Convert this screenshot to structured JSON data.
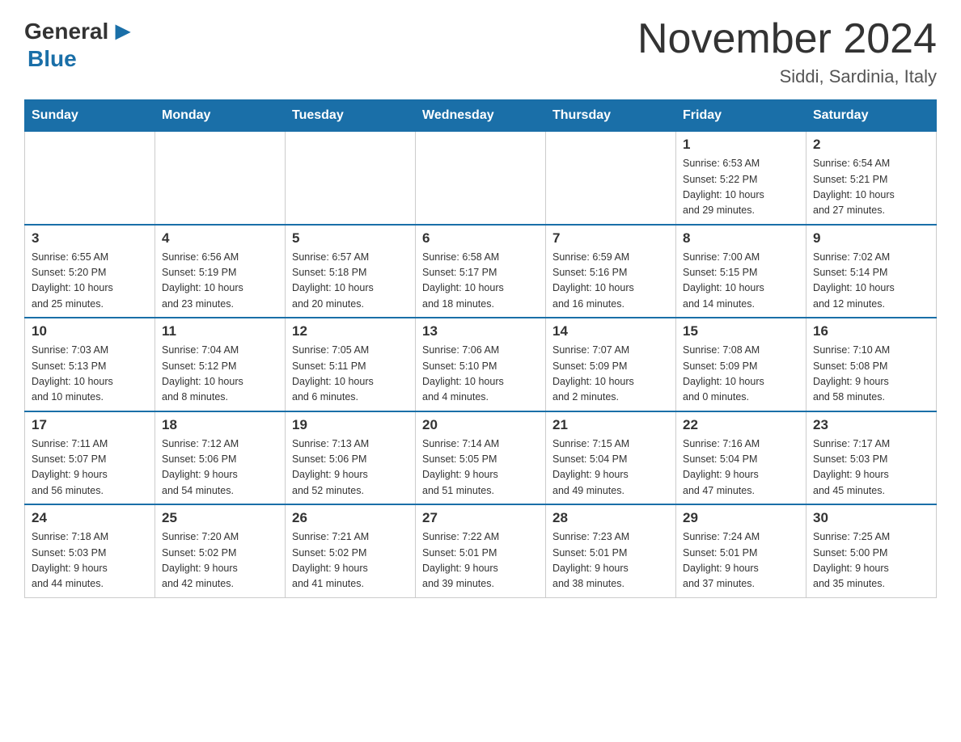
{
  "header": {
    "logo_general": "General",
    "logo_blue": "Blue",
    "title": "November 2024",
    "location": "Siddi, Sardinia, Italy"
  },
  "weekdays": [
    "Sunday",
    "Monday",
    "Tuesday",
    "Wednesday",
    "Thursday",
    "Friday",
    "Saturday"
  ],
  "weeks": [
    [
      {
        "day": "",
        "info": ""
      },
      {
        "day": "",
        "info": ""
      },
      {
        "day": "",
        "info": ""
      },
      {
        "day": "",
        "info": ""
      },
      {
        "day": "",
        "info": ""
      },
      {
        "day": "1",
        "info": "Sunrise: 6:53 AM\nSunset: 5:22 PM\nDaylight: 10 hours\nand 29 minutes."
      },
      {
        "day": "2",
        "info": "Sunrise: 6:54 AM\nSunset: 5:21 PM\nDaylight: 10 hours\nand 27 minutes."
      }
    ],
    [
      {
        "day": "3",
        "info": "Sunrise: 6:55 AM\nSunset: 5:20 PM\nDaylight: 10 hours\nand 25 minutes."
      },
      {
        "day": "4",
        "info": "Sunrise: 6:56 AM\nSunset: 5:19 PM\nDaylight: 10 hours\nand 23 minutes."
      },
      {
        "day": "5",
        "info": "Sunrise: 6:57 AM\nSunset: 5:18 PM\nDaylight: 10 hours\nand 20 minutes."
      },
      {
        "day": "6",
        "info": "Sunrise: 6:58 AM\nSunset: 5:17 PM\nDaylight: 10 hours\nand 18 minutes."
      },
      {
        "day": "7",
        "info": "Sunrise: 6:59 AM\nSunset: 5:16 PM\nDaylight: 10 hours\nand 16 minutes."
      },
      {
        "day": "8",
        "info": "Sunrise: 7:00 AM\nSunset: 5:15 PM\nDaylight: 10 hours\nand 14 minutes."
      },
      {
        "day": "9",
        "info": "Sunrise: 7:02 AM\nSunset: 5:14 PM\nDaylight: 10 hours\nand 12 minutes."
      }
    ],
    [
      {
        "day": "10",
        "info": "Sunrise: 7:03 AM\nSunset: 5:13 PM\nDaylight: 10 hours\nand 10 minutes."
      },
      {
        "day": "11",
        "info": "Sunrise: 7:04 AM\nSunset: 5:12 PM\nDaylight: 10 hours\nand 8 minutes."
      },
      {
        "day": "12",
        "info": "Sunrise: 7:05 AM\nSunset: 5:11 PM\nDaylight: 10 hours\nand 6 minutes."
      },
      {
        "day": "13",
        "info": "Sunrise: 7:06 AM\nSunset: 5:10 PM\nDaylight: 10 hours\nand 4 minutes."
      },
      {
        "day": "14",
        "info": "Sunrise: 7:07 AM\nSunset: 5:09 PM\nDaylight: 10 hours\nand 2 minutes."
      },
      {
        "day": "15",
        "info": "Sunrise: 7:08 AM\nSunset: 5:09 PM\nDaylight: 10 hours\nand 0 minutes."
      },
      {
        "day": "16",
        "info": "Sunrise: 7:10 AM\nSunset: 5:08 PM\nDaylight: 9 hours\nand 58 minutes."
      }
    ],
    [
      {
        "day": "17",
        "info": "Sunrise: 7:11 AM\nSunset: 5:07 PM\nDaylight: 9 hours\nand 56 minutes."
      },
      {
        "day": "18",
        "info": "Sunrise: 7:12 AM\nSunset: 5:06 PM\nDaylight: 9 hours\nand 54 minutes."
      },
      {
        "day": "19",
        "info": "Sunrise: 7:13 AM\nSunset: 5:06 PM\nDaylight: 9 hours\nand 52 minutes."
      },
      {
        "day": "20",
        "info": "Sunrise: 7:14 AM\nSunset: 5:05 PM\nDaylight: 9 hours\nand 51 minutes."
      },
      {
        "day": "21",
        "info": "Sunrise: 7:15 AM\nSunset: 5:04 PM\nDaylight: 9 hours\nand 49 minutes."
      },
      {
        "day": "22",
        "info": "Sunrise: 7:16 AM\nSunset: 5:04 PM\nDaylight: 9 hours\nand 47 minutes."
      },
      {
        "day": "23",
        "info": "Sunrise: 7:17 AM\nSunset: 5:03 PM\nDaylight: 9 hours\nand 45 minutes."
      }
    ],
    [
      {
        "day": "24",
        "info": "Sunrise: 7:18 AM\nSunset: 5:03 PM\nDaylight: 9 hours\nand 44 minutes."
      },
      {
        "day": "25",
        "info": "Sunrise: 7:20 AM\nSunset: 5:02 PM\nDaylight: 9 hours\nand 42 minutes."
      },
      {
        "day": "26",
        "info": "Sunrise: 7:21 AM\nSunset: 5:02 PM\nDaylight: 9 hours\nand 41 minutes."
      },
      {
        "day": "27",
        "info": "Sunrise: 7:22 AM\nSunset: 5:01 PM\nDaylight: 9 hours\nand 39 minutes."
      },
      {
        "day": "28",
        "info": "Sunrise: 7:23 AM\nSunset: 5:01 PM\nDaylight: 9 hours\nand 38 minutes."
      },
      {
        "day": "29",
        "info": "Sunrise: 7:24 AM\nSunset: 5:01 PM\nDaylight: 9 hours\nand 37 minutes."
      },
      {
        "day": "30",
        "info": "Sunrise: 7:25 AM\nSunset: 5:00 PM\nDaylight: 9 hours\nand 35 minutes."
      }
    ]
  ]
}
